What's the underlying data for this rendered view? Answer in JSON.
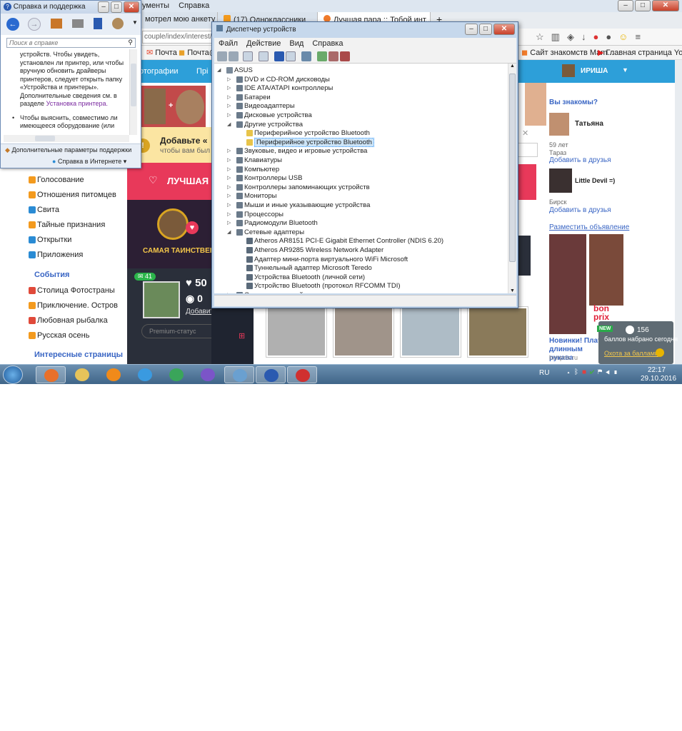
{
  "help_window": {
    "title": "Справка и поддержка",
    "search_placeholder": "Поиск в справке",
    "body_paragraph": "устройств. Чтобы увидеть, установлен ли принтер, или чтобы вручную обновить драйверы принтеров, следует открыть папку «Устройства и принтеры». Дополнительные сведения см. в разделе",
    "body_link": "Установка принтера.",
    "bullet_text": "Чтобы выяснить, совместимо ли имеющееся оборудование (или",
    "footer_link": "Дополнительные параметры поддержки",
    "online_help": "Справка в Интернете"
  },
  "browser": {
    "menu_partial": [
      "ументы",
      "Справка"
    ],
    "tabs": [
      "мотрел мою анкету ...",
      "(17) Одноклассники",
      "Лучшая пара :: Тобой инт..."
    ],
    "url_partial": "couple/index/interest/!fo",
    "bookmarks": [
      "Почта",
      "Почта@",
      "Сайт знакомств Mam...",
      "Главная страница Yo..."
    ],
    "ok_user": "ИРИША",
    "ok_nav_partial": [
      "отографии",
      "Прі"
    ],
    "left_menu": [
      {
        "label": "Голосование",
        "color": "#f39a1e"
      },
      {
        "label": "Отношения питомцев",
        "color": "#f39a1e"
      },
      {
        "label": "Свита",
        "color": "#2a8bd4"
      },
      {
        "label": "Тайные признания",
        "color": "#f39a1e"
      },
      {
        "label": "Открытки",
        "color": "#2a8bd4"
      },
      {
        "label": "Приложения",
        "color": "#2a8bd4"
      }
    ],
    "events_header": "События",
    "events_menu": [
      {
        "label": "Столица Фотостраны",
        "color": "#e04a3a"
      },
      {
        "label": "Приключение. Остров",
        "color": "#f39a1e"
      },
      {
        "label": "Любовная рыбалка",
        "color": "#e04a3a"
      },
      {
        "label": "Русская осень",
        "color": "#f39a1e"
      }
    ],
    "interesting_header": "Интересные страницы",
    "promo_title": "Добавьте «",
    "promo_sub": "чтобы вам был",
    "best_pair": "ЛУЧШАЯ",
    "mysterious": "САМАЯ ТАИНСТВЕНН",
    "likes": "50",
    "views": "0",
    "msg_count": "41",
    "add_link": "Добавить",
    "premium": "Premium-статус",
    "you_know": "Вы знакомы?",
    "person1_name": "Татьяна",
    "person1_age": "59 лет",
    "person1_city": "Тараз",
    "add_friend": "Добавить в друзья",
    "person2_name": "Little Devil =)",
    "person2_city": "Бирск",
    "ad_link": "Разместить объявление",
    "ad_text": "Новинки! Плать длинным рукава",
    "ad_domain": "bonprix.ru",
    "brand": "bon prix"
  },
  "device_manager": {
    "title": "Диспетчер устройств",
    "menu": [
      "Файл",
      "Действие",
      "Вид",
      "Справка"
    ],
    "tree": [
      {
        "label": "ASUS",
        "level": 0,
        "expanded": true
      },
      {
        "label": "DVD и CD-ROM дисководы",
        "level": 1
      },
      {
        "label": "IDE ATA/ATAPI контроллеры",
        "level": 1
      },
      {
        "label": "Батареи",
        "level": 1
      },
      {
        "label": "Видеоадаптеры",
        "level": 1
      },
      {
        "label": "Дисковые устройства",
        "level": 1
      },
      {
        "label": "Другие устройства",
        "level": 1,
        "expanded": true
      },
      {
        "label": "Периферийное устройство Bluetooth",
        "level": 2,
        "warning": true
      },
      {
        "label": "Периферийное устройство Bluetooth",
        "level": 2,
        "warning": true,
        "selected": true
      },
      {
        "label": "Звуковые, видео и игровые устройства",
        "level": 1
      },
      {
        "label": "Клавиатуры",
        "level": 1
      },
      {
        "label": "Компьютер",
        "level": 1
      },
      {
        "label": "Контроллеры USB",
        "level": 1
      },
      {
        "label": "Контроллеры запоминающих устройств",
        "level": 1
      },
      {
        "label": "Мониторы",
        "level": 1
      },
      {
        "label": "Мыши и иные указывающие устройства",
        "level": 1
      },
      {
        "label": "Процессоры",
        "level": 1
      },
      {
        "label": "Радиомодули Bluetooth",
        "level": 1
      },
      {
        "label": "Сетевые адаптеры",
        "level": 1,
        "expanded": true
      },
      {
        "label": "Atheros AR8151 PCI-E Gigabit Ethernet Controller (NDIS 6.20)",
        "level": 2
      },
      {
        "label": "Atheros AR9285 Wireless Network Adapter",
        "level": 2
      },
      {
        "label": "Адаптер мини-порта виртуального WiFi Microsoft",
        "level": 2
      },
      {
        "label": "Туннельный адаптер Microsoft Teredo",
        "level": 2
      },
      {
        "label": "Устройства Bluetooth (личной сети)",
        "level": 2
      },
      {
        "label": "Устройство Bluetooth (протокол RFCOMM TDI)",
        "level": 2
      },
      {
        "label": "Системные устройства",
        "level": 1
      }
    ]
  },
  "notification": {
    "badge": "NEW",
    "points": "156",
    "points_text": "баллов набрано сегодня",
    "link": "Охота за баллами"
  },
  "taskbar": {
    "apps": [
      {
        "name": "firefox",
        "color": "#e8702a",
        "active": true
      },
      {
        "name": "explorer",
        "color": "#e6c35a"
      },
      {
        "name": "media-player",
        "color": "#f08a1a"
      },
      {
        "name": "ie",
        "color": "#3a9ae0"
      },
      {
        "name": "chrome",
        "color": "#3aa55a"
      },
      {
        "name": "viber",
        "color": "#7b55c8"
      },
      {
        "name": "screen",
        "color": "#6aa0d0",
        "active": true
      },
      {
        "name": "help",
        "color": "#2a5ab0",
        "active": true
      },
      {
        "name": "toolbox",
        "color": "#d03030",
        "active": true
      }
    ],
    "lang": "RU",
    "time": "22:17",
    "date": "29.10.2016"
  }
}
